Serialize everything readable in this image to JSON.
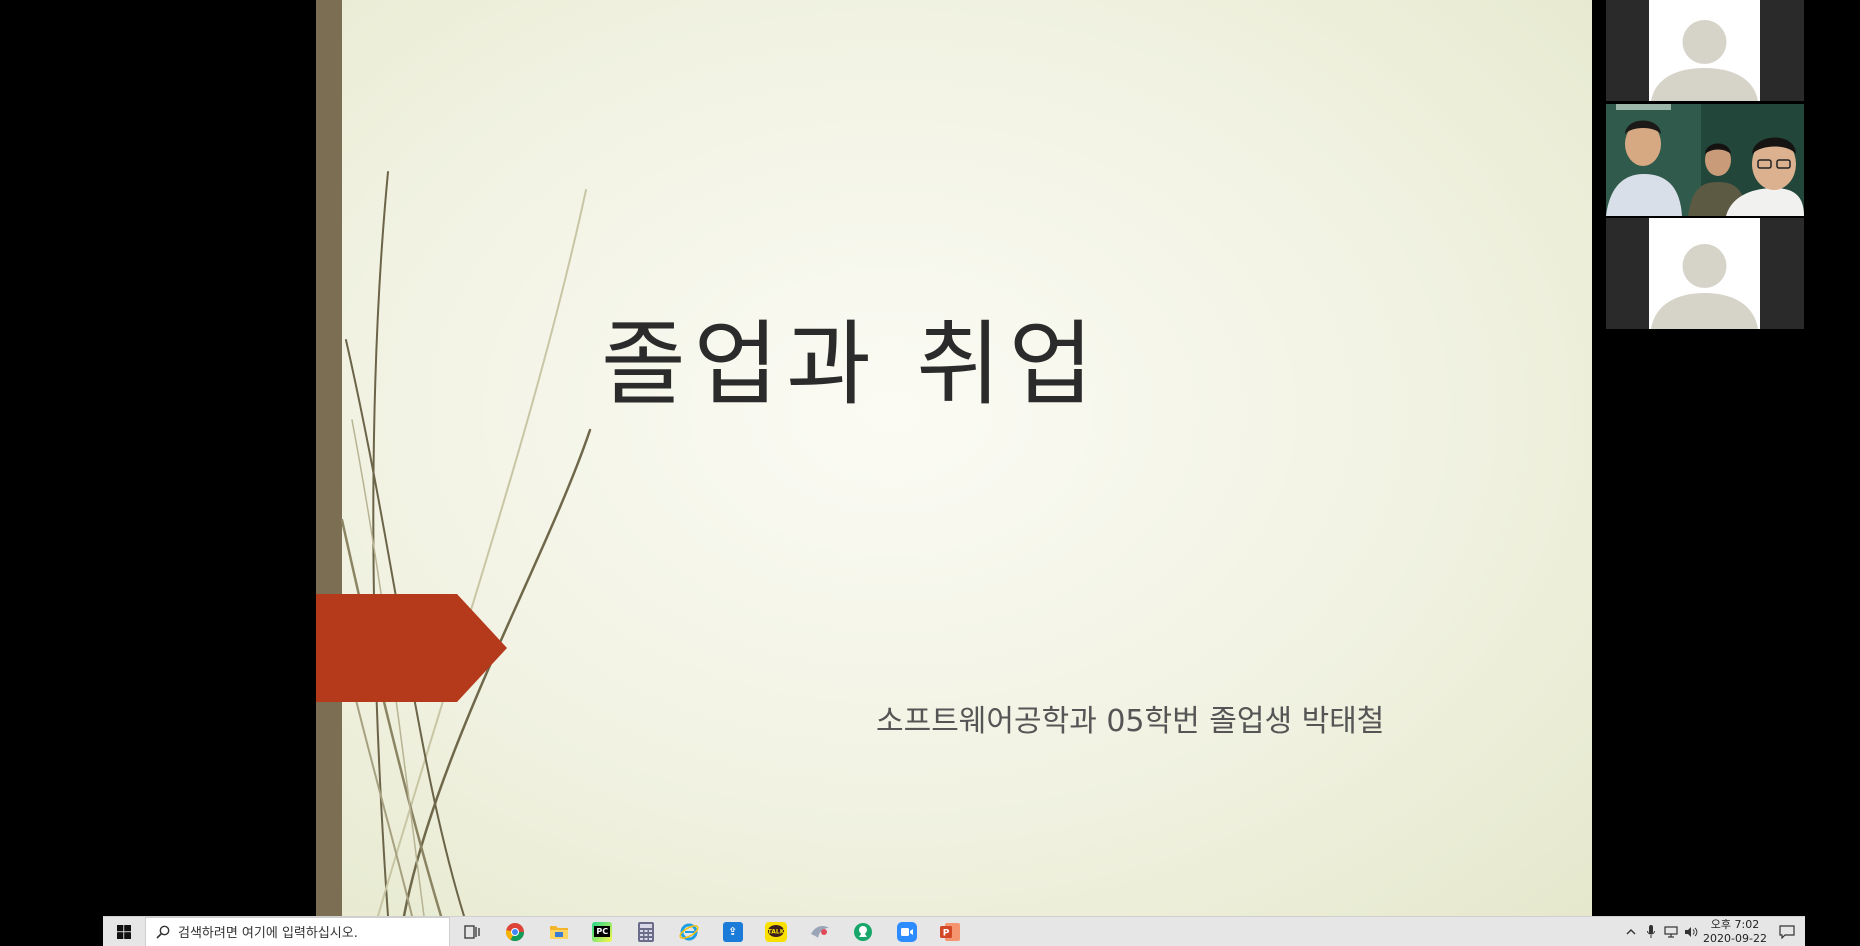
{
  "slide": {
    "title": "졸업과 취업",
    "subtitle": "소프트웨어공학과 05학번 졸업생 박태철",
    "colors": {
      "accent": "#b5391b",
      "bar": "#7b6e52",
      "background": "#f1f2e2"
    }
  },
  "participants": [
    {
      "kind": "avatar",
      "icon": "person-silhouette-icon"
    },
    {
      "kind": "video",
      "people": 3
    },
    {
      "kind": "avatar",
      "icon": "person-silhouette-icon"
    }
  ],
  "taskbar": {
    "search_placeholder": "검색하려면 여기에 입력하십시오.",
    "apps": [
      {
        "name": "task-view",
        "icon": "task-view-icon",
        "color": "#333333"
      },
      {
        "name": "chrome",
        "icon": "chrome-icon",
        "color": "#4285f4"
      },
      {
        "name": "file-explorer",
        "icon": "folder-icon",
        "color": "#f3b52b"
      },
      {
        "name": "pycharm",
        "icon": "pycharm-icon",
        "color": "#21d789"
      },
      {
        "name": "calculator",
        "icon": "calculator-icon",
        "color": "#6b6b8a"
      },
      {
        "name": "internet-explorer",
        "icon": "ie-icon",
        "color": "#1ea0e6"
      },
      {
        "name": "app-blue",
        "icon": "blue-app-icon",
        "color": "#1a7bd8"
      },
      {
        "name": "kakaotalk",
        "icon": "kakaotalk-icon",
        "color": "#f9e000"
      },
      {
        "name": "app-bird",
        "icon": "bird-icon",
        "color": "#e8e8e8"
      },
      {
        "name": "app-green",
        "icon": "green-app-icon",
        "color": "#17a76b"
      },
      {
        "name": "zoom",
        "icon": "zoom-icon",
        "color": "#2d8cff"
      },
      {
        "name": "powerpoint",
        "icon": "powerpoint-icon",
        "color": "#d24726"
      }
    ],
    "clock": {
      "time": "오후 7:02",
      "date": "2020-09-22"
    }
  }
}
